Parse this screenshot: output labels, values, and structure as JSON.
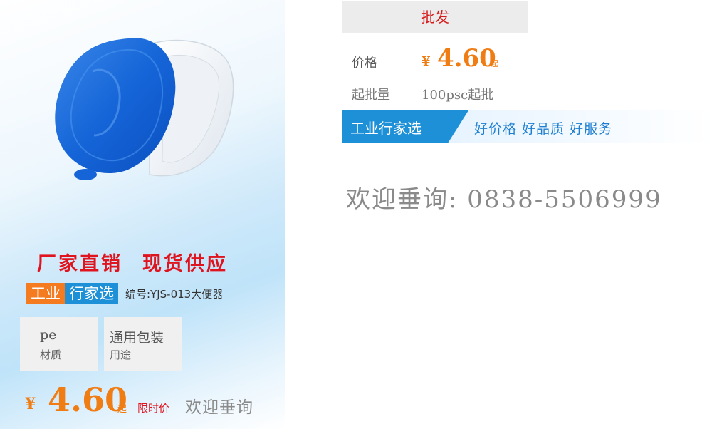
{
  "left": {
    "slogan": [
      "厂家直销",
      "现货供应"
    ],
    "badge": {
      "part1": "工业",
      "part2": "行家选"
    },
    "product_code": "编号:YJS-013大便器",
    "specs": [
      {
        "value": "pe",
        "label": "材质"
      },
      {
        "value": "通用包装",
        "label": "用途"
      }
    ],
    "price": {
      "currency": "¥",
      "amount": "4.60",
      "suffix": "起",
      "limit_label": "限时价",
      "inquire": "欢迎垂询"
    }
  },
  "right": {
    "tab_label": "批发",
    "price_label": "价格",
    "price": {
      "currency": "¥",
      "amount": "4.60",
      "suffix": "起"
    },
    "min_qty_label": "起批量",
    "min_qty_value": "100psc起批",
    "banner": {
      "tag": "工业行家选",
      "slogan": "好价格  好品质  好服务"
    },
    "contact": "欢迎垂询: 0838-5506999"
  },
  "colors": {
    "accent_orange": "#f07d14",
    "accent_red": "#e0141e",
    "accent_blue": "#1e90d8",
    "text_gray": "#8a8a8a"
  },
  "icons": {
    "product_image": "blue-bedpan-with-white-tray"
  }
}
